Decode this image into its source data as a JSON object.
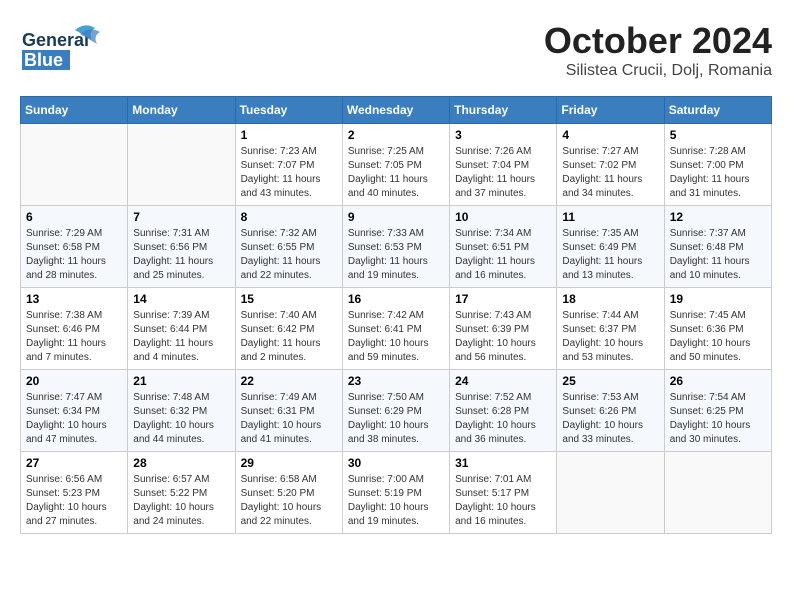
{
  "header": {
    "logo_general": "General",
    "logo_blue": "Blue",
    "month_title": "October 2024",
    "location": "Silistea Crucii, Dolj, Romania"
  },
  "weekdays": [
    "Sunday",
    "Monday",
    "Tuesday",
    "Wednesday",
    "Thursday",
    "Friday",
    "Saturday"
  ],
  "weeks": [
    [
      {
        "day": "",
        "info": ""
      },
      {
        "day": "",
        "info": ""
      },
      {
        "day": "1",
        "info": "Sunrise: 7:23 AM\nSunset: 7:07 PM\nDaylight: 11 hours and 43 minutes."
      },
      {
        "day": "2",
        "info": "Sunrise: 7:25 AM\nSunset: 7:05 PM\nDaylight: 11 hours and 40 minutes."
      },
      {
        "day": "3",
        "info": "Sunrise: 7:26 AM\nSunset: 7:04 PM\nDaylight: 11 hours and 37 minutes."
      },
      {
        "day": "4",
        "info": "Sunrise: 7:27 AM\nSunset: 7:02 PM\nDaylight: 11 hours and 34 minutes."
      },
      {
        "day": "5",
        "info": "Sunrise: 7:28 AM\nSunset: 7:00 PM\nDaylight: 11 hours and 31 minutes."
      }
    ],
    [
      {
        "day": "6",
        "info": "Sunrise: 7:29 AM\nSunset: 6:58 PM\nDaylight: 11 hours and 28 minutes."
      },
      {
        "day": "7",
        "info": "Sunrise: 7:31 AM\nSunset: 6:56 PM\nDaylight: 11 hours and 25 minutes."
      },
      {
        "day": "8",
        "info": "Sunrise: 7:32 AM\nSunset: 6:55 PM\nDaylight: 11 hours and 22 minutes."
      },
      {
        "day": "9",
        "info": "Sunrise: 7:33 AM\nSunset: 6:53 PM\nDaylight: 11 hours and 19 minutes."
      },
      {
        "day": "10",
        "info": "Sunrise: 7:34 AM\nSunset: 6:51 PM\nDaylight: 11 hours and 16 minutes."
      },
      {
        "day": "11",
        "info": "Sunrise: 7:35 AM\nSunset: 6:49 PM\nDaylight: 11 hours and 13 minutes."
      },
      {
        "day": "12",
        "info": "Sunrise: 7:37 AM\nSunset: 6:48 PM\nDaylight: 11 hours and 10 minutes."
      }
    ],
    [
      {
        "day": "13",
        "info": "Sunrise: 7:38 AM\nSunset: 6:46 PM\nDaylight: 11 hours and 7 minutes."
      },
      {
        "day": "14",
        "info": "Sunrise: 7:39 AM\nSunset: 6:44 PM\nDaylight: 11 hours and 4 minutes."
      },
      {
        "day": "15",
        "info": "Sunrise: 7:40 AM\nSunset: 6:42 PM\nDaylight: 11 hours and 2 minutes."
      },
      {
        "day": "16",
        "info": "Sunrise: 7:42 AM\nSunset: 6:41 PM\nDaylight: 10 hours and 59 minutes."
      },
      {
        "day": "17",
        "info": "Sunrise: 7:43 AM\nSunset: 6:39 PM\nDaylight: 10 hours and 56 minutes."
      },
      {
        "day": "18",
        "info": "Sunrise: 7:44 AM\nSunset: 6:37 PM\nDaylight: 10 hours and 53 minutes."
      },
      {
        "day": "19",
        "info": "Sunrise: 7:45 AM\nSunset: 6:36 PM\nDaylight: 10 hours and 50 minutes."
      }
    ],
    [
      {
        "day": "20",
        "info": "Sunrise: 7:47 AM\nSunset: 6:34 PM\nDaylight: 10 hours and 47 minutes."
      },
      {
        "day": "21",
        "info": "Sunrise: 7:48 AM\nSunset: 6:32 PM\nDaylight: 10 hours and 44 minutes."
      },
      {
        "day": "22",
        "info": "Sunrise: 7:49 AM\nSunset: 6:31 PM\nDaylight: 10 hours and 41 minutes."
      },
      {
        "day": "23",
        "info": "Sunrise: 7:50 AM\nSunset: 6:29 PM\nDaylight: 10 hours and 38 minutes."
      },
      {
        "day": "24",
        "info": "Sunrise: 7:52 AM\nSunset: 6:28 PM\nDaylight: 10 hours and 36 minutes."
      },
      {
        "day": "25",
        "info": "Sunrise: 7:53 AM\nSunset: 6:26 PM\nDaylight: 10 hours and 33 minutes."
      },
      {
        "day": "26",
        "info": "Sunrise: 7:54 AM\nSunset: 6:25 PM\nDaylight: 10 hours and 30 minutes."
      }
    ],
    [
      {
        "day": "27",
        "info": "Sunrise: 6:56 AM\nSunset: 5:23 PM\nDaylight: 10 hours and 27 minutes."
      },
      {
        "day": "28",
        "info": "Sunrise: 6:57 AM\nSunset: 5:22 PM\nDaylight: 10 hours and 24 minutes."
      },
      {
        "day": "29",
        "info": "Sunrise: 6:58 AM\nSunset: 5:20 PM\nDaylight: 10 hours and 22 minutes."
      },
      {
        "day": "30",
        "info": "Sunrise: 7:00 AM\nSunset: 5:19 PM\nDaylight: 10 hours and 19 minutes."
      },
      {
        "day": "31",
        "info": "Sunrise: 7:01 AM\nSunset: 5:17 PM\nDaylight: 10 hours and 16 minutes."
      },
      {
        "day": "",
        "info": ""
      },
      {
        "day": "",
        "info": ""
      }
    ]
  ]
}
